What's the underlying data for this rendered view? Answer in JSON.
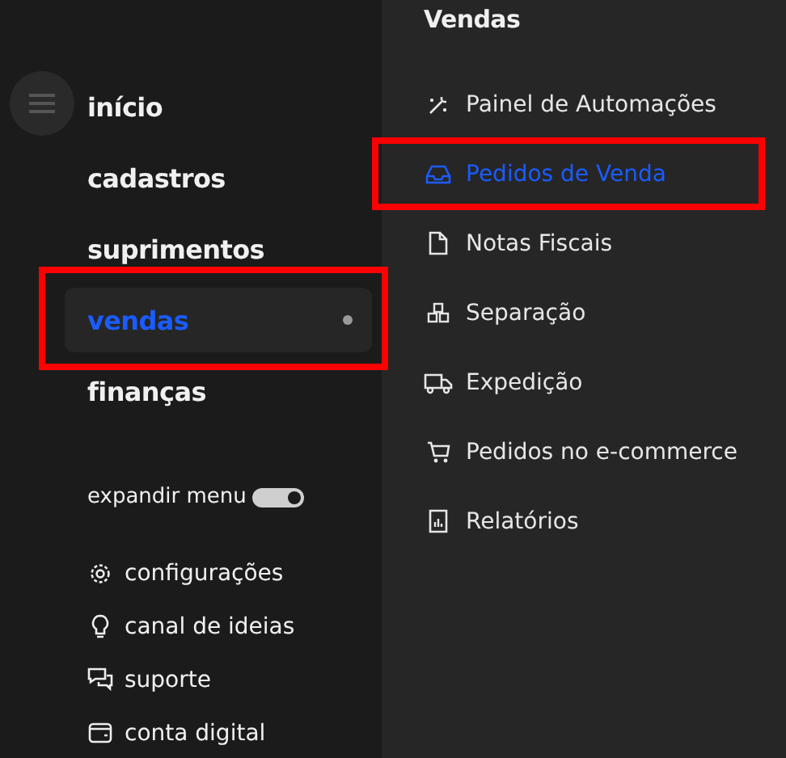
{
  "main_menu": [
    {
      "label": "início",
      "selected": false,
      "highlighted": false
    },
    {
      "label": "cadastros",
      "selected": false,
      "highlighted": false
    },
    {
      "label": "suprimentos",
      "selected": false,
      "highlighted": false
    },
    {
      "label": "vendas",
      "selected": true,
      "highlighted": true
    },
    {
      "label": "finanças",
      "selected": false,
      "highlighted": false
    }
  ],
  "expand_menu": {
    "label": "expandir menu",
    "on": true
  },
  "footer_links": [
    {
      "kind": "gear",
      "label": "configurações"
    },
    {
      "kind": "bulb",
      "label": "canal de ideias"
    },
    {
      "kind": "chat",
      "label": "suporte"
    },
    {
      "kind": "wallet",
      "label": "conta digital"
    }
  ],
  "submenu": {
    "title": "Vendas",
    "items": [
      {
        "kind": "wand",
        "label": "Painel de Automações",
        "selected": false,
        "highlighted": false
      },
      {
        "kind": "inbox",
        "label": "Pedidos de Venda",
        "selected": true,
        "highlighted": true
      },
      {
        "kind": "file",
        "label": "Notas Fiscais",
        "selected": false,
        "highlighted": false
      },
      {
        "kind": "boxes",
        "label": "Separação",
        "selected": false,
        "highlighted": false
      },
      {
        "kind": "truck",
        "label": "Expedição",
        "selected": false,
        "highlighted": false
      },
      {
        "kind": "cart",
        "label": "Pedidos no e-commerce",
        "selected": false,
        "highlighted": false
      },
      {
        "kind": "report",
        "label": "Relatórios",
        "selected": false,
        "highlighted": false
      }
    ]
  }
}
